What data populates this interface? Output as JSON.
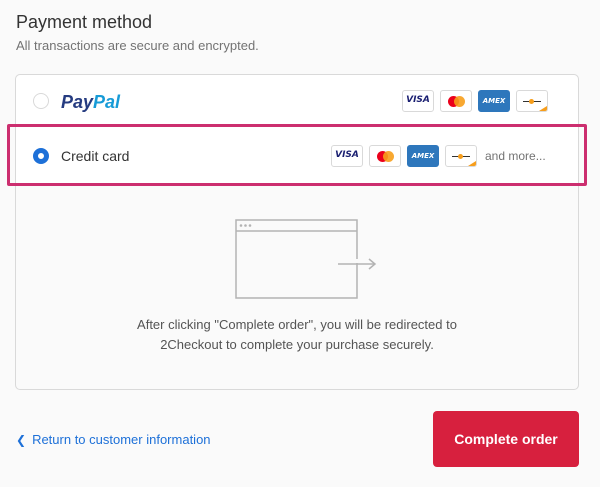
{
  "header": {
    "title": "Payment method",
    "subtitle": "All transactions are secure and encrypted."
  },
  "options": {
    "paypal": {
      "logo_part1": "Pay",
      "logo_part2": "Pal",
      "selected": false,
      "cards": [
        "VISA",
        "mastercard",
        "AMEX",
        "discover"
      ]
    },
    "credit_card": {
      "label": "Credit card",
      "selected": true,
      "cards": [
        "VISA",
        "mastercard",
        "AMEX",
        "discover"
      ],
      "more_text": "and more..."
    }
  },
  "card_labels": {
    "visa": "VISA",
    "amex": "AMEX"
  },
  "redirect": {
    "line1": "After clicking \"Complete order\", you will be redirected to",
    "line2": "2Checkout to complete your purchase securely."
  },
  "footer": {
    "return_label": "Return to customer information",
    "complete_label": "Complete order"
  },
  "colors": {
    "accent": "#1d70d8",
    "primary_button": "#d7203e",
    "highlight": "#cc2e6f"
  }
}
